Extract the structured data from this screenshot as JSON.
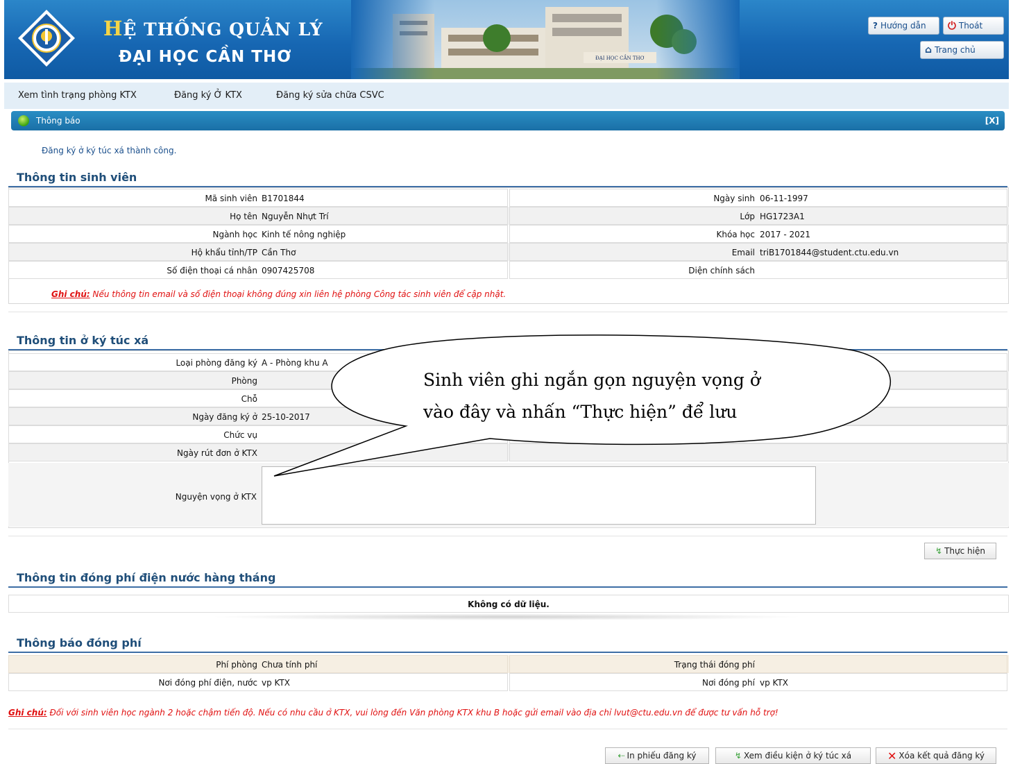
{
  "header": {
    "title_first_letter": "H",
    "title_rest": "Ệ THỐNG QUẢN LÝ",
    "subtitle": "ĐẠI HỌC CẦN THƠ",
    "help_label": "Hướng dẫn",
    "logout_label": "Thoát",
    "home_label": "Trang chủ",
    "logo_text": "ĐẠI HỌC CẦN THƠ"
  },
  "menu": {
    "items": [
      {
        "label": "Xem tình trạng phòng KTX"
      },
      {
        "label": "Đăng ký Ở KTX"
      },
      {
        "label": "Đăng ký sửa chữa CSVC"
      }
    ]
  },
  "notice": {
    "title": "Thông báo",
    "close_label": "[X]",
    "message": "Đăng ký ở ký túc xá thành công."
  },
  "student_info": {
    "section_title": "Thông tin sinh viên",
    "rows": [
      {
        "left_label": "Mã sinh viên",
        "left_value": "B1701844",
        "right_label": "Ngày sinh",
        "right_value": "06-11-1997"
      },
      {
        "left_label": "Họ tên",
        "left_value": "Nguyễn Nhựt Trí",
        "right_label": "Lớp",
        "right_value": "HG1723A1"
      },
      {
        "left_label": "Ngành học",
        "left_value": "Kinh tế nông nghiệp",
        "right_label": "Khóa học",
        "right_value": "2017 - 2021"
      },
      {
        "left_label": "Hộ khẩu tỉnh/TP",
        "left_value": "Cần Thơ",
        "right_label": "Email",
        "right_value": "triB1701844@student.ctu.edu.vn"
      },
      {
        "left_label": "Số điện thoại cá nhân",
        "left_value": "0907425708",
        "right_label": "Diện chính sách",
        "right_value": ""
      }
    ],
    "note_label": "Ghi chú:",
    "note_text": " Nếu thông tin email và số điện thoại không đúng xin liên hệ phòng Công tác sinh viên để cập nhật."
  },
  "dorm_info": {
    "section_title": "Thông tin ở ký túc xá",
    "rows": [
      {
        "label": "Loại phòng đăng ký",
        "value": "A - Phòng khu A"
      },
      {
        "label": "Phòng",
        "value": ""
      },
      {
        "label": "Chỗ",
        "value": ""
      },
      {
        "label": "Ngày đăng ký ở",
        "value": "25-10-2017"
      },
      {
        "label": "Chức vụ",
        "value": ""
      },
      {
        "label": "Ngày rút đơn ở KTX",
        "value": ""
      }
    ],
    "wish_label": "Nguyện vọng ở KTX",
    "wish_value": "",
    "submit_label": "Thực hiện"
  },
  "fees_monthly": {
    "section_title": "Thông tin đóng phí điện nước hàng tháng",
    "empty_message": "Không có dữ liệu."
  },
  "fee_notice": {
    "section_title": "Thông báo đóng phí",
    "rows": [
      {
        "left_label": "Phí phòng",
        "left_value": "Chưa tính phí",
        "right_label": "Trạng thái đóng phí",
        "right_value": ""
      },
      {
        "left_label": "Nơi đóng phí điện, nước",
        "left_value": "vp KTX",
        "right_label": "Nơi đóng phí",
        "right_value": "vp KTX"
      }
    ]
  },
  "footer_note": {
    "label": "Ghi chú:",
    "text": " Đối với sinh viên học ngành 2 hoặc chậm tiến độ. Nếu có nhu cầu ở KTX, vui lòng đến Văn phòng KTX khu B hoặc gửi email vào địa chỉ lvut@ctu.edu.vn để được tư vấn hỗ trợ!"
  },
  "actions": {
    "print_label": "In phiếu đăng ký",
    "conditions_label": "Xem điều kiện ở ký túc xá",
    "delete_label": "Xóa kết quả đăng ký"
  },
  "callout": {
    "line1": "Sinh viên ghi ngắn gọn nguyện vọng ở",
    "line2": "vào đây và nhấn “Thực hiện” để lưu"
  },
  "colors": {
    "header_blue": "#1767b3",
    "section_title": "#1f4e79",
    "note_red": "#e01010",
    "notice_bar": "#1a6fa6"
  }
}
